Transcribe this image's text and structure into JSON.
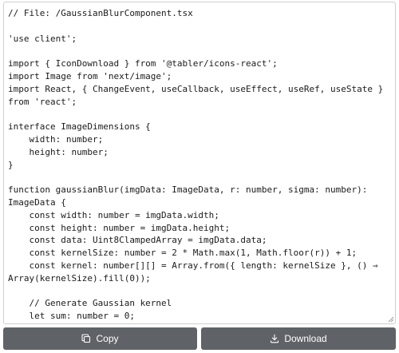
{
  "editor": {
    "lines": [
      "// File: /GaussianBlurComponent.tsx",
      "",
      "'use client';",
      "",
      "import { IconDownload } from '@tabler/icons-react';",
      "import Image from 'next/image';",
      "import React, { ChangeEvent, useCallback, useEffect, useRef, useState }",
      "from 'react';",
      "",
      "interface ImageDimensions {",
      "    width: number;",
      "    height: number;",
      "}",
      "",
      "function gaussianBlur(imgData: ImageData, r: number, sigma: number):",
      "ImageData {",
      "    const width: number = imgData.width;",
      "    const height: number = imgData.height;",
      "    const data: Uint8ClampedArray = imgData.data;",
      "    const kernelSize: number = 2 * Math.max(1, Math.floor(r)) + 1;",
      "    const kernel: number[][] = Array.from({ length: kernelSize }, () ⇒",
      "Array(kernelSize).fill(0));",
      "",
      "    // Generate Gaussian kernel",
      "    let sum: number = 0;"
    ]
  },
  "actions": {
    "copy_label": "Copy",
    "copy_icon": "copy-icon",
    "download_label": "Download",
    "download_icon": "download-icon"
  },
  "colors": {
    "button_bg": "#5f6368",
    "button_text": "#ffffff",
    "code_text": "#1a1a1a",
    "panel_border": "#cfcfcf"
  }
}
